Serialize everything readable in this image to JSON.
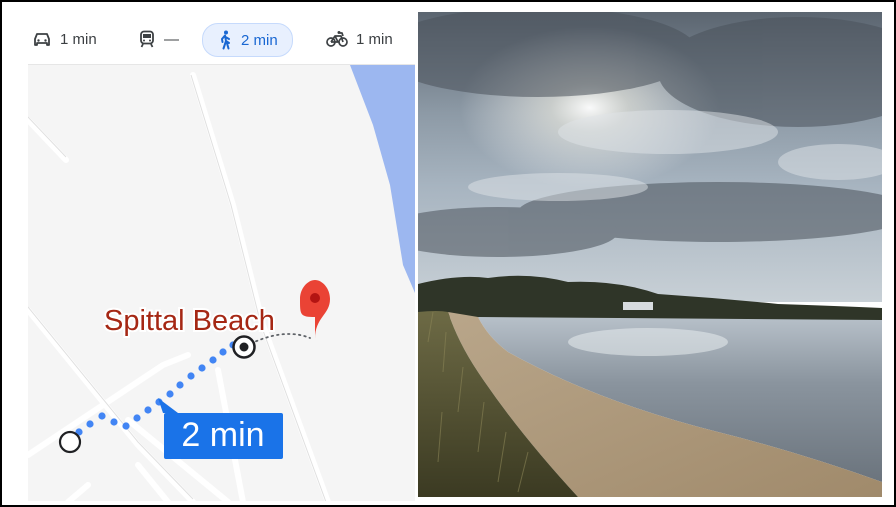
{
  "transport_modes": [
    {
      "name": "drive",
      "icon": "car-icon",
      "label": "1 min",
      "active": false
    },
    {
      "name": "transit",
      "icon": "train-icon",
      "label": "—",
      "active": false
    },
    {
      "name": "walk",
      "icon": "walking-icon",
      "label": "2 min",
      "active": true
    },
    {
      "name": "bike",
      "icon": "bicycle-icon",
      "label": "1 min",
      "active": false
    }
  ],
  "map": {
    "destination_label": "Spittal Beach",
    "route_duration": "2 min",
    "colors": {
      "route": "#4285f4",
      "label_text": "#a52714",
      "water": "#9cb7f0",
      "pin": "#ea4335",
      "duration_bg": "#1a73e8"
    }
  },
  "photo": {
    "description_icon": "beach-photo"
  }
}
